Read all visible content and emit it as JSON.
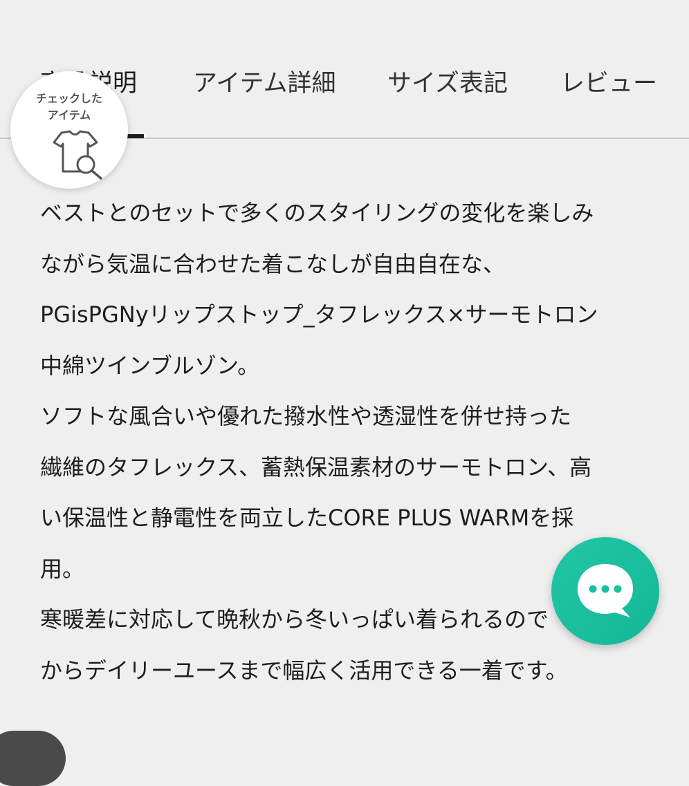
{
  "tabs": [
    {
      "label": "商品説明",
      "active": true
    },
    {
      "label": "アイテム詳細",
      "active": false
    },
    {
      "label": "サイズ表記",
      "active": false
    },
    {
      "label": "レビュー",
      "active": false
    }
  ],
  "checked_items": {
    "label_line1": "チェックした",
    "label_line2": "アイテム",
    "icon": "tshirt-search-icon"
  },
  "description": {
    "lines": [
      "ベストとのセットで多くのスタイリングの変化を楽しみ",
      "ながら気温に合わせた着こなしが自由自在な、",
      "PGisPGNyリップストップ_タフレックス×サーモトロン",
      "中綿ツインブルゾン。",
      "ソフトな風合いや優れた撥水性や透湿性を併せ持った",
      "繊維のタフレックス、蓄熱保温素材のサーモトロン、高",
      "い保温性と静電性を両立したCORE PLUS WARMを採",
      "用。",
      "寒暖差に対応して晩秋から冬いっぱい着られるので",
      "からデイリーユースまで幅広く活用できる一着です。"
    ]
  },
  "chat_button": {
    "icon": "chat-bubble-icon",
    "color": "#19bf9f"
  }
}
